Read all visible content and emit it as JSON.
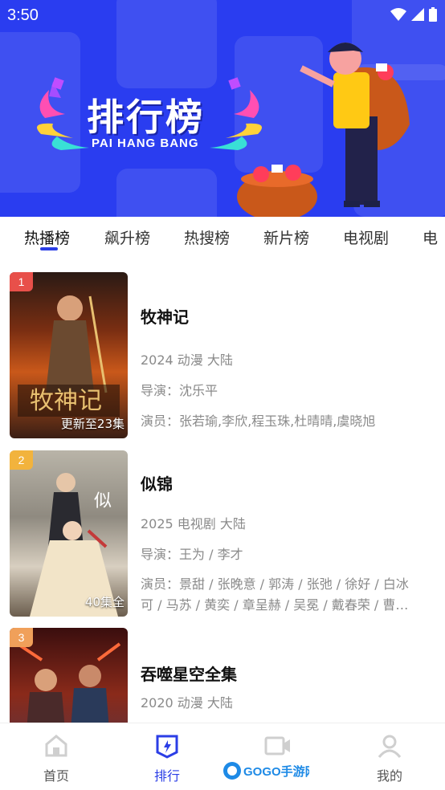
{
  "status_bar": {
    "time": "3:50",
    "icons": [
      "wifi-icon",
      "signal-icon",
      "battery-icon"
    ]
  },
  "banner": {
    "title": "排行榜",
    "subtitle": "PAI HANG BANG",
    "background_color": "#2a3df0"
  },
  "tabs": [
    {
      "label": "热播榜",
      "active": true
    },
    {
      "label": "飙升榜",
      "active": false
    },
    {
      "label": "热搜榜",
      "active": false
    },
    {
      "label": "新片榜",
      "active": false
    },
    {
      "label": "电视剧",
      "active": false
    },
    {
      "label": "电",
      "active": false
    }
  ],
  "items": [
    {
      "rank": "1",
      "rank_color": "#e8504a",
      "poster_tag": "更新至23集",
      "title": "牧神记",
      "meta": "2024 动漫 大陆",
      "director": "导演：沈乐平",
      "cast": "演员：张若瑜,李欣,程玉珠,杜晴晴,虞晓旭"
    },
    {
      "rank": "2",
      "rank_color": "#f2b33d",
      "poster_tag": "40集全",
      "title": "似锦",
      "meta": "2025 电视剧 大陆",
      "director": "导演：王为 / 李才",
      "cast_line1": "演员：景甜 / 张晚意 / 郭涛 / 张弛 / 徐好 / 白冰",
      "cast_line2": "可 / 马苏 / 黄奕 / 章呈赫 / 吴冕 / 戴春荣 / 曹…"
    },
    {
      "rank": "3",
      "rank_color": "#f0a05a",
      "title": "吞噬星空全集",
      "meta": "2020 动漫 大陆"
    }
  ],
  "bottom_nav": [
    {
      "label": "首页",
      "icon": "home-icon",
      "active": false
    },
    {
      "label": "排行",
      "icon": "ranking-icon",
      "active": true
    },
    {
      "label": "",
      "icon": "video-icon",
      "active": false
    },
    {
      "label": "我的",
      "icon": "profile-icon",
      "active": false
    }
  ],
  "watermark": {
    "text": "GOGO手游网"
  },
  "accent_color": "#2b3ee6"
}
